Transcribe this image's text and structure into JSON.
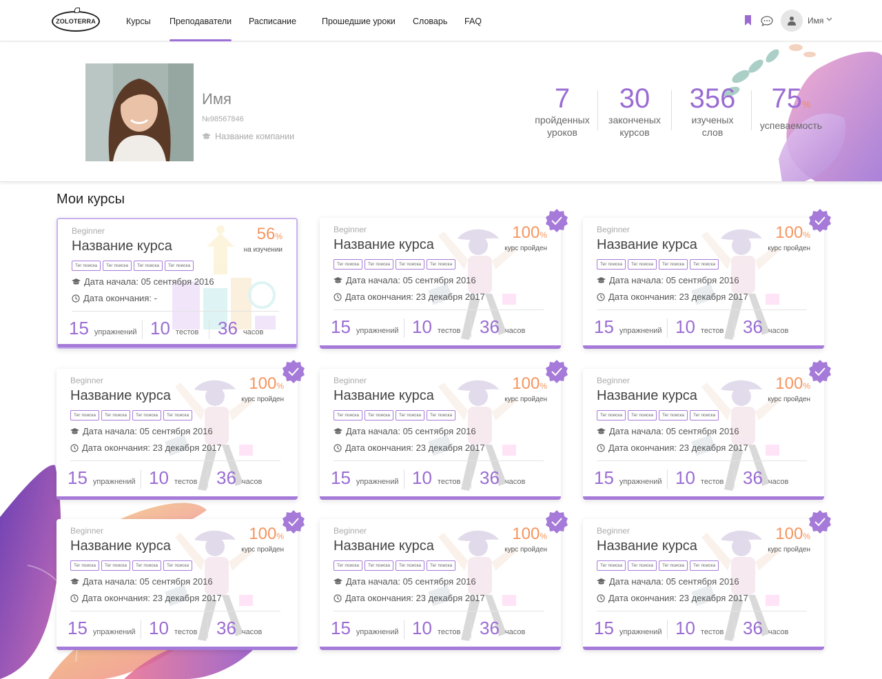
{
  "header": {
    "logo_text": "ZOLOTERRA",
    "nav": [
      {
        "label": "Курсы",
        "active": false
      },
      {
        "label": "Преподаватели",
        "active": true
      },
      {
        "label": "Расписание",
        "active": false
      },
      {
        "label": "Прошедшие уроки",
        "active": false
      },
      {
        "label": "Словарь",
        "active": false
      },
      {
        "label": "FAQ",
        "active": false
      }
    ],
    "icons": [
      "bookmark-icon",
      "chat-icon",
      "user-icon",
      "chevron-down-icon"
    ],
    "user_name": "Имя"
  },
  "profile": {
    "name": "Имя",
    "id": "№98567846",
    "company": "Название компании",
    "stats": [
      {
        "value": "7",
        "suffix": "",
        "label": "пройденных уроков"
      },
      {
        "value": "30",
        "suffix": "",
        "label": "законченых курсов"
      },
      {
        "value": "356",
        "suffix": "",
        "label": "изученых слов"
      },
      {
        "value": "75",
        "suffix": "%",
        "label": "успеваемость"
      }
    ]
  },
  "section_title": "Мои курсы",
  "courses": [
    {
      "level": "Beginner",
      "title": "Название курса",
      "tags": [
        "Тег поиска",
        "Тег поиска",
        "Тег поиска",
        "Тег поиска"
      ],
      "start_label": "Дата начала: 05 сентября 2016",
      "end_label": "Дата окончания: -",
      "percent": "56",
      "percent_sign": "%",
      "status": "на изучении",
      "completed": false,
      "exercises": "15",
      "exercises_label": "упражнений",
      "tests": "10",
      "tests_label": "тестов",
      "hours": "36",
      "hours_label": "часов"
    },
    {
      "level": "Beginner",
      "title": "Название курса",
      "tags": [
        "Тег поиска",
        "Тег поиска",
        "Тег поиска",
        "Тег поиска"
      ],
      "start_label": "Дата начала: 05 сентября 2016",
      "end_label": "Дата окончания: 23 декабря 2017",
      "percent": "100",
      "percent_sign": "%",
      "status": "курс пройден",
      "completed": true,
      "exercises": "15",
      "exercises_label": "упражнений",
      "tests": "10",
      "tests_label": "тестов",
      "hours": "36",
      "hours_label": "часов"
    },
    {
      "level": "Beginner",
      "title": "Название курса",
      "tags": [
        "Тег поиска",
        "Тег поиска",
        "Тег поиска",
        "Тег поиска"
      ],
      "start_label": "Дата начала: 05 сентября 2016",
      "end_label": "Дата окончания: 23 декабря 2017",
      "percent": "100",
      "percent_sign": "%",
      "status": "курс пройден",
      "completed": true,
      "exercises": "15",
      "exercises_label": "упражнений",
      "tests": "10",
      "tests_label": "тестов",
      "hours": "36",
      "hours_label": "часов"
    },
    {
      "level": "Beginner",
      "title": "Название курса",
      "tags": [
        "Тег поиска",
        "Тег поиска",
        "Тег поиска",
        "Тег поиска"
      ],
      "start_label": "Дата начала: 05 сентября 2016",
      "end_label": "Дата окончания: 23 декабря 2017",
      "percent": "100",
      "percent_sign": "%",
      "status": "курс пройден",
      "completed": true,
      "exercises": "15",
      "exercises_label": "упражнений",
      "tests": "10",
      "tests_label": "тестов",
      "hours": "36",
      "hours_label": "часов"
    },
    {
      "level": "Beginner",
      "title": "Название курса",
      "tags": [
        "Тег поиска",
        "Тег поиска",
        "Тег поиска",
        "Тег поиска"
      ],
      "start_label": "Дата начала: 05 сентября 2016",
      "end_label": "Дата окончания: 23 декабря 2017",
      "percent": "100",
      "percent_sign": "%",
      "status": "курс пройден",
      "completed": true,
      "exercises": "15",
      "exercises_label": "упражнений",
      "tests": "10",
      "tests_label": "тестов",
      "hours": "36",
      "hours_label": "часов"
    },
    {
      "level": "Beginner",
      "title": "Название курса",
      "tags": [
        "Тег поиска",
        "Тег поиска",
        "Тег поиска",
        "Тег поиска"
      ],
      "start_label": "Дата начала: 05 сентября 2016",
      "end_label": "Дата окончания: 23 декабря 2017",
      "percent": "100",
      "percent_sign": "%",
      "status": "курс пройден",
      "completed": true,
      "exercises": "15",
      "exercises_label": "упражнений",
      "tests": "10",
      "tests_label": "тестов",
      "hours": "36",
      "hours_label": "часов"
    },
    {
      "level": "Beginner",
      "title": "Название курса",
      "tags": [
        "Тег поиска",
        "Тег поиска",
        "Тег поиска",
        "Тег поиска"
      ],
      "start_label": "Дата начала: 05 сентября 2016",
      "end_label": "Дата окончания: 23 декабря 2017",
      "percent": "100",
      "percent_sign": "%",
      "status": "курс пройден",
      "completed": true,
      "exercises": "15",
      "exercises_label": "упражнений",
      "tests": "10",
      "tests_label": "тестов",
      "hours": "36",
      "hours_label": "часов"
    },
    {
      "level": "Beginner",
      "title": "Название курса",
      "tags": [
        "Тег поиска",
        "Тег поиска",
        "Тег поиска",
        "Тег поиска"
      ],
      "start_label": "Дата начала: 05 сентября 2016",
      "end_label": "Дата окончания: 23 декабря 2017",
      "percent": "100",
      "percent_sign": "%",
      "status": "курс пройден",
      "completed": true,
      "exercises": "15",
      "exercises_label": "упражнений",
      "tests": "10",
      "tests_label": "тестов",
      "hours": "36",
      "hours_label": "часов"
    },
    {
      "level": "Beginner",
      "title": "Название курса",
      "tags": [
        "Тег поиска",
        "Тег поиска",
        "Тег поиска",
        "Тег поиска"
      ],
      "start_label": "Дата начала: 05 сентября 2016",
      "end_label": "Дата окончания: 23 декабря 2017",
      "percent": "100",
      "percent_sign": "%",
      "status": "курс пройден",
      "completed": true,
      "exercises": "15",
      "exercises_label": "упражнений",
      "tests": "10",
      "tests_label": "тестов",
      "hours": "36",
      "hours_label": "часов"
    }
  ],
  "colors": {
    "accent": "#9a6cd3",
    "percent": "#f5955f",
    "badge": "#a57ad8"
  }
}
